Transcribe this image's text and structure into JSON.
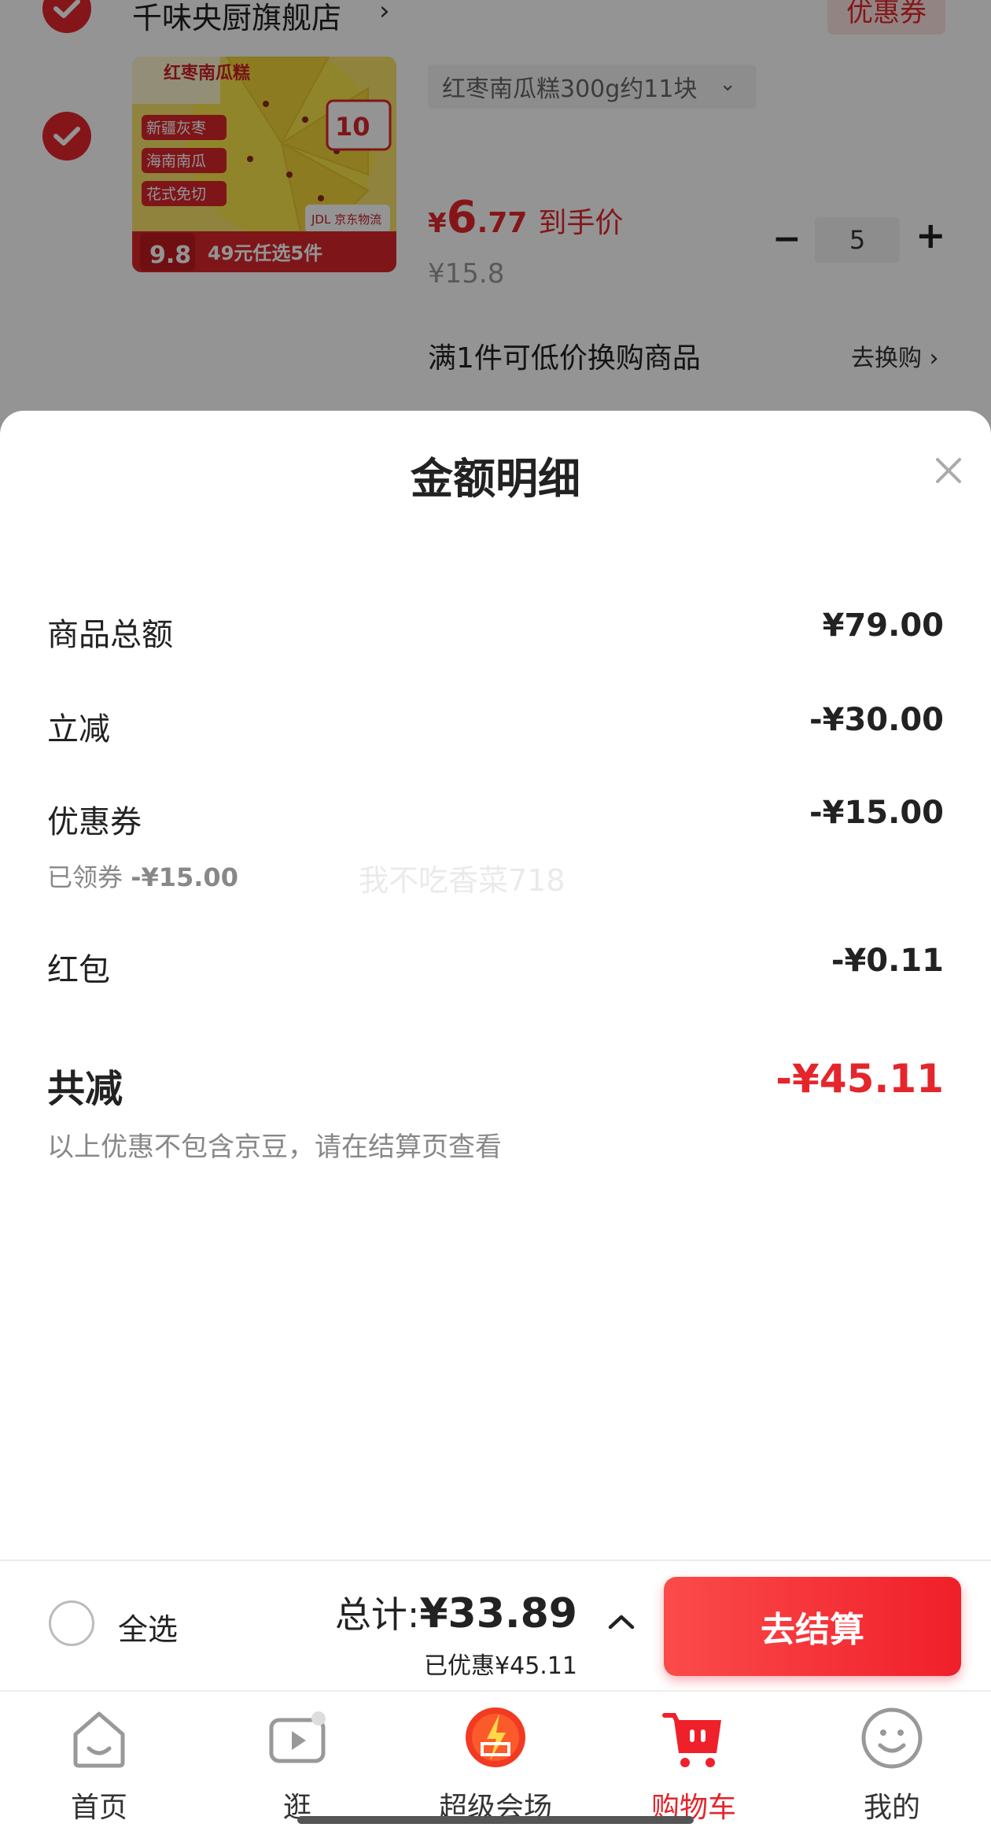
{
  "background_cart": {
    "store_name": "千味央厨旗舰店",
    "store_chevron": "›",
    "coupon_tag": "优惠券",
    "product": {
      "image_texts": {
        "name": "红枣南瓜糕",
        "tag1": "新疆灰枣",
        "tag2": "海南南瓜",
        "tag3": "花式免切",
        "badge_num": "10",
        "deal_price": "9.8",
        "deal_text": "49元任选5件",
        "logistics": "JDL 京东物流"
      },
      "variant": "红枣南瓜糕300g约11块",
      "price_currency": "¥",
      "price_int": "6",
      "price_dec": ".77",
      "price_label": "到手价",
      "original_price": "¥15.8",
      "quantity": "5",
      "minus": "−",
      "plus": "+"
    },
    "promo_text": "满1件可低价换购商品",
    "promo_link": "去换购 ›"
  },
  "sheet": {
    "title": "金额明细",
    "rows": [
      {
        "label": "商品总额",
        "value": "¥79.00"
      },
      {
        "label": "立减",
        "value": "-¥30.00"
      },
      {
        "label": "优惠券",
        "value": "-¥15.00"
      },
      {
        "label": "红包",
        "value": "-¥0.11"
      }
    ],
    "coupon_sub_label": "已领券",
    "coupon_sub_value": "-¥15.00",
    "watermark": "我不吃香菜718",
    "total_label": "共减",
    "total_value": "-¥45.11",
    "footnote": "以上优惠不包含京豆，请在结算页查看"
  },
  "checkout": {
    "select_all": "全选",
    "total_key": "总计:",
    "total_value": "¥33.89",
    "saved": "已优惠¥45.11",
    "button": "去结算"
  },
  "tabs": [
    {
      "label": "首页",
      "icon": "home-icon"
    },
    {
      "label": "逛",
      "icon": "video-play-icon"
    },
    {
      "label": "超级会场",
      "icon": "super-venue-icon"
    },
    {
      "label": "购物车",
      "icon": "cart-icon",
      "active": true
    },
    {
      "label": "我的",
      "icon": "smiley-profile-icon"
    }
  ],
  "colors": {
    "accent": "#e4262c",
    "muted": "#888888",
    "overlay": "rgba(0,0,0,0.42)"
  }
}
